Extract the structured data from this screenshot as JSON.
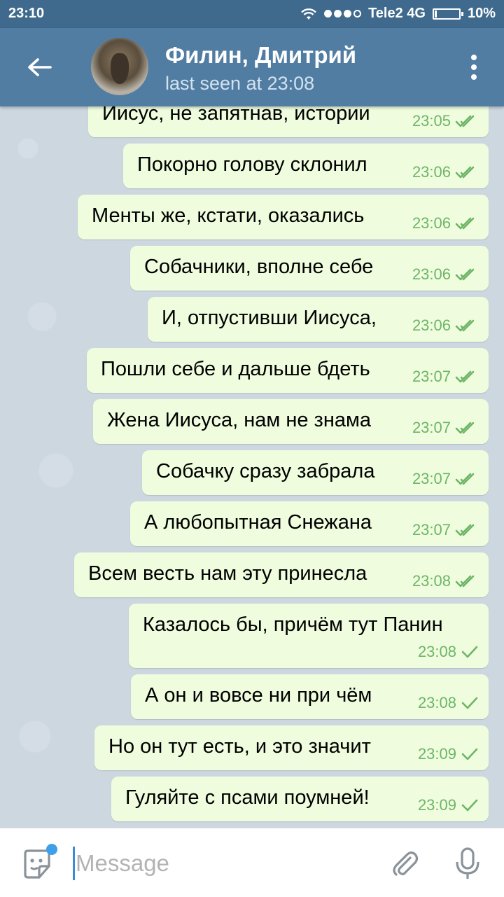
{
  "status_bar": {
    "time": "23:10",
    "carrier": "Tele2 4G",
    "battery": "10%",
    "battery_level": 0.1,
    "signal_bars": 3
  },
  "header": {
    "title": "Филин, Дмитрий",
    "subtitle": "last seen at 23:08"
  },
  "messages": [
    {
      "text": "Иисус, не запятнав, истории",
      "time": "23:05",
      "status": "read"
    },
    {
      "text": "Покорно голову склонил",
      "time": "23:06",
      "status": "read"
    },
    {
      "text": "Менты же, кстати, оказались",
      "time": "23:06",
      "status": "read"
    },
    {
      "text": "Собачники, вполне себе",
      "time": "23:06",
      "status": "read"
    },
    {
      "text": "И, отпустивши Иисуса,",
      "time": "23:06",
      "status": "read"
    },
    {
      "text": "Пошли себе и дальше бдеть",
      "time": "23:07",
      "status": "read"
    },
    {
      "text": "Жена Иисуса, нам не знама",
      "time": "23:07",
      "status": "read"
    },
    {
      "text": "Собачку сразу забрала",
      "time": "23:07",
      "status": "read"
    },
    {
      "text": "А любопытная Снежана",
      "time": "23:07",
      "status": "read"
    },
    {
      "text": "Всем весть нам эту принесла",
      "time": "23:08",
      "status": "read"
    },
    {
      "text": "Казалось бы, причём тут Панин",
      "time": "23:08",
      "status": "sent"
    },
    {
      "text": "А он и вовсе ни при чём",
      "time": "23:08",
      "status": "sent"
    },
    {
      "text": "Но он тут есть, и это значит",
      "time": "23:09",
      "status": "sent"
    },
    {
      "text": "Гуляйте с псами поумней!",
      "time": "23:09",
      "status": "sent"
    }
  ],
  "input": {
    "placeholder": "Message"
  },
  "colors": {
    "header": "#517da2",
    "status_bar": "#3f6a8d",
    "bubble_out": "#effdde",
    "check": "#6db566",
    "accent": "#3ea0ea"
  },
  "icons": [
    "back-arrow-icon",
    "more-vert-icon",
    "sticker-icon",
    "attach-icon",
    "mic-icon",
    "double-check-icon",
    "check-icon",
    "wifi-icon",
    "battery-icon"
  ]
}
